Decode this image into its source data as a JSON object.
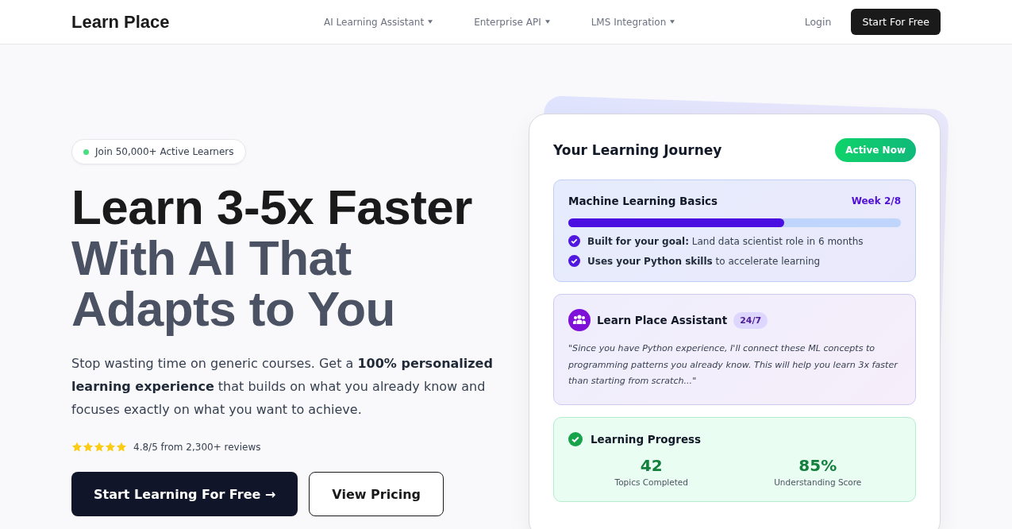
{
  "header": {
    "logo": "Learn Place",
    "nav": [
      {
        "label": "AI Learning Assistant",
        "has_menu": true
      },
      {
        "label": "Enterprise API",
        "has_menu": true
      },
      {
        "label": "LMS Integration",
        "has_menu": true
      }
    ],
    "login": "Login",
    "cta": "Start For Free"
  },
  "hero": {
    "badge": {
      "text": "Join 50,000+ Active Learners",
      "color": "#4ade80"
    },
    "headline": {
      "lead": "Learn 3-5x Faster",
      "rest": [
        "With AI That",
        "Adapts to You"
      ]
    },
    "description": "Stop wasting time on generic courses. Get a **100% personalized learning experience** that builds on what you already know and focuses exactly on what you want to achieve.",
    "rating": {
      "stars": 5,
      "text": "4.8/5 from 2,300+ reviews"
    },
    "buttons": [
      {
        "label": "Start Learning For Free →",
        "kind": "primary"
      },
      {
        "label": "View Pricing",
        "kind": "secondary"
      }
    ]
  },
  "journey": {
    "title": "Your Learning Journey",
    "status": "Active Now",
    "course": {
      "name": "Machine Learning Basics",
      "week": "Week 2/8",
      "level": 0.65,
      "points": [
        "**Built for your goal:** Land data scientist role in 6 months",
        "**Uses your Python skills** to accelerate learning"
      ]
    },
    "assistant": {
      "name": "Learn Place Assistant",
      "badge": "24/7",
      "quote": "\"Since you have Python experience, I'll connect these ML concepts to programming patterns you already know. This will help you learn 3x faster than starting from scratch...\""
    },
    "progress": {
      "title": "Learning Progress",
      "stats": [
        {
          "value": "42",
          "label": "Topics Completed"
        },
        {
          "value": "85%",
          "label": "Understanding Score"
        }
      ]
    }
  }
}
